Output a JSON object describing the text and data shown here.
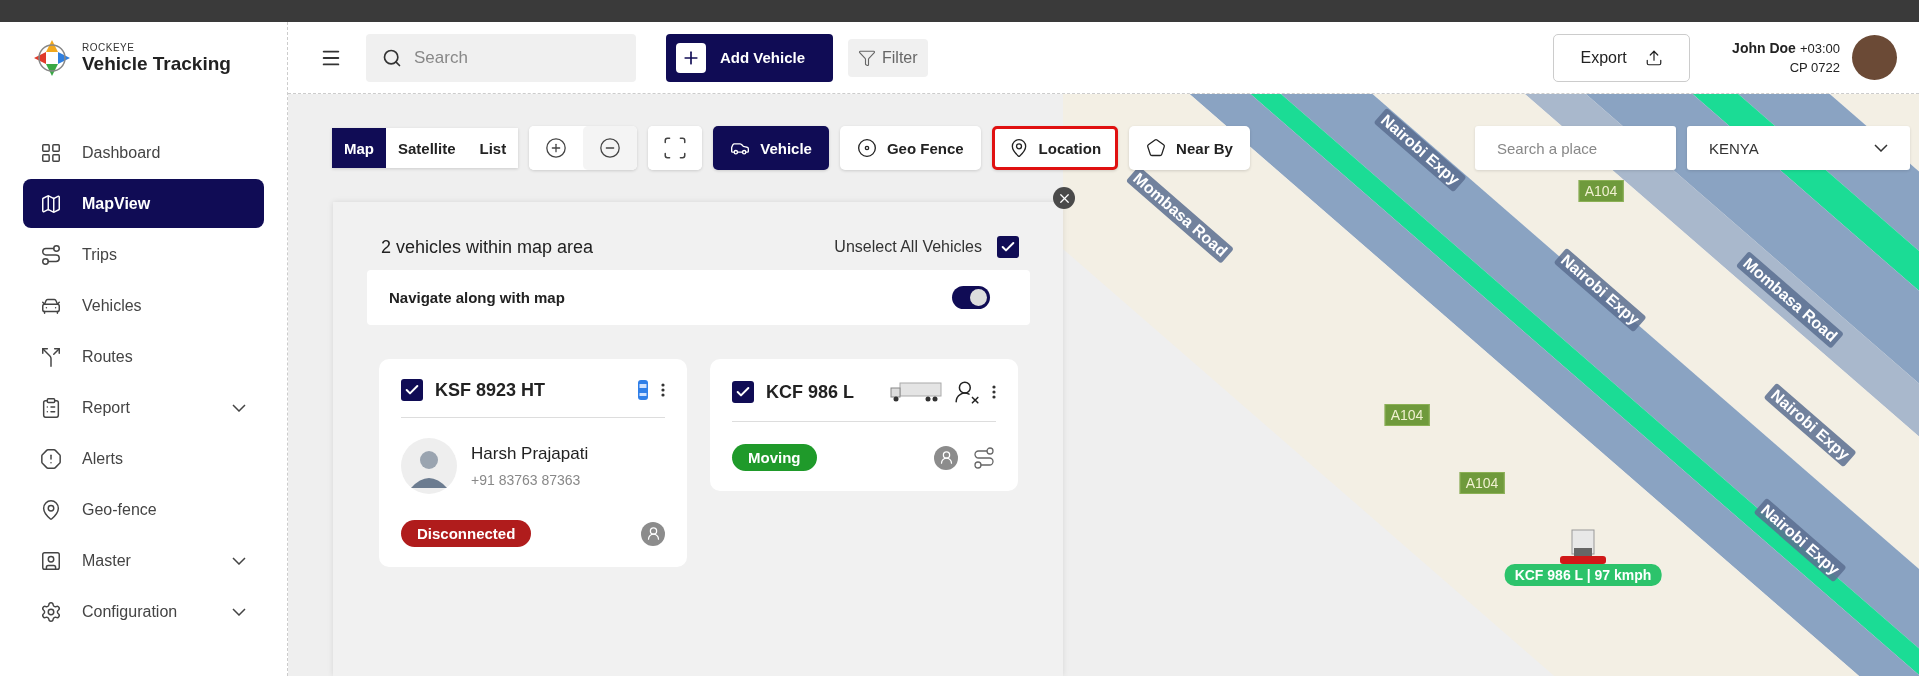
{
  "brand": {
    "small": "ROCKEYE",
    "name": "Vehicle Tracking"
  },
  "sidebar": {
    "items": [
      {
        "label": "Dashboard",
        "selected": false,
        "has_submenu": false
      },
      {
        "label": "MapView",
        "selected": true,
        "has_submenu": false
      },
      {
        "label": "Trips",
        "selected": false,
        "has_submenu": false
      },
      {
        "label": "Vehicles",
        "selected": false,
        "has_submenu": false
      },
      {
        "label": "Routes",
        "selected": false,
        "has_submenu": false
      },
      {
        "label": "Report",
        "selected": false,
        "has_submenu": true
      },
      {
        "label": "Alerts",
        "selected": false,
        "has_submenu": false
      },
      {
        "label": "Geo-fence",
        "selected": false,
        "has_submenu": false
      },
      {
        "label": "Master",
        "selected": false,
        "has_submenu": true
      },
      {
        "label": "Configuration",
        "selected": false,
        "has_submenu": true
      }
    ]
  },
  "header": {
    "search": {
      "placeholder": "Search"
    },
    "add_button": "Add Vehicle",
    "filter_button": "Filter",
    "export_button": "Export",
    "user": {
      "name": "John Doe",
      "timezone": "+03:00",
      "code": "CP 0722"
    }
  },
  "toolbar": {
    "views": [
      {
        "label": "Map",
        "selected": true
      },
      {
        "label": "Satellite",
        "selected": false
      },
      {
        "label": "List",
        "selected": false
      }
    ],
    "tools": [
      {
        "label": "Vehicle",
        "selected": true,
        "focused": false
      },
      {
        "label": "Geo Fence",
        "selected": false,
        "focused": false
      },
      {
        "label": "Location",
        "selected": false,
        "focused": true
      },
      {
        "label": "Near By",
        "selected": false,
        "focused": false
      }
    ],
    "place_search": {
      "placeholder": "Search a place"
    },
    "country": "KENYA"
  },
  "panel": {
    "title": "2 vehicles within map area",
    "unselect_label": "Unselect All Vehicles",
    "unselect_checked": true,
    "navigate_label": "Navigate along with map",
    "navigate_on": true,
    "vehicles": [
      {
        "plate": "KSF 8923 HT",
        "kind": "car",
        "checked": true,
        "driver": {
          "name": "Harsh Prajapati",
          "phone": "+91 83763 87363"
        },
        "status": "Disconnected",
        "color": "#b01c1c"
      },
      {
        "plate": "KCF 986 L",
        "kind": "truck",
        "checked": true,
        "status": "Moving",
        "color": "#1f9a2a"
      }
    ]
  },
  "map": {
    "labels": [
      {
        "kind": "road",
        "text": "Mombasa Road"
      },
      {
        "kind": "road",
        "text": "Nairobi Expy"
      },
      {
        "kind": "shield",
        "text": "A104"
      },
      {
        "kind": "road",
        "text": "Nairobi Expy"
      },
      {
        "kind": "road",
        "text": "Mombasa Road"
      },
      {
        "kind": "road",
        "text": "Nairobi Expy"
      },
      {
        "kind": "shield",
        "text": "A104"
      },
      {
        "kind": "shield",
        "text": "A104"
      },
      {
        "kind": "road",
        "text": "Nairobi Expy"
      }
    ],
    "vehicle_label": "KCF 986 L | 97 kmph"
  }
}
